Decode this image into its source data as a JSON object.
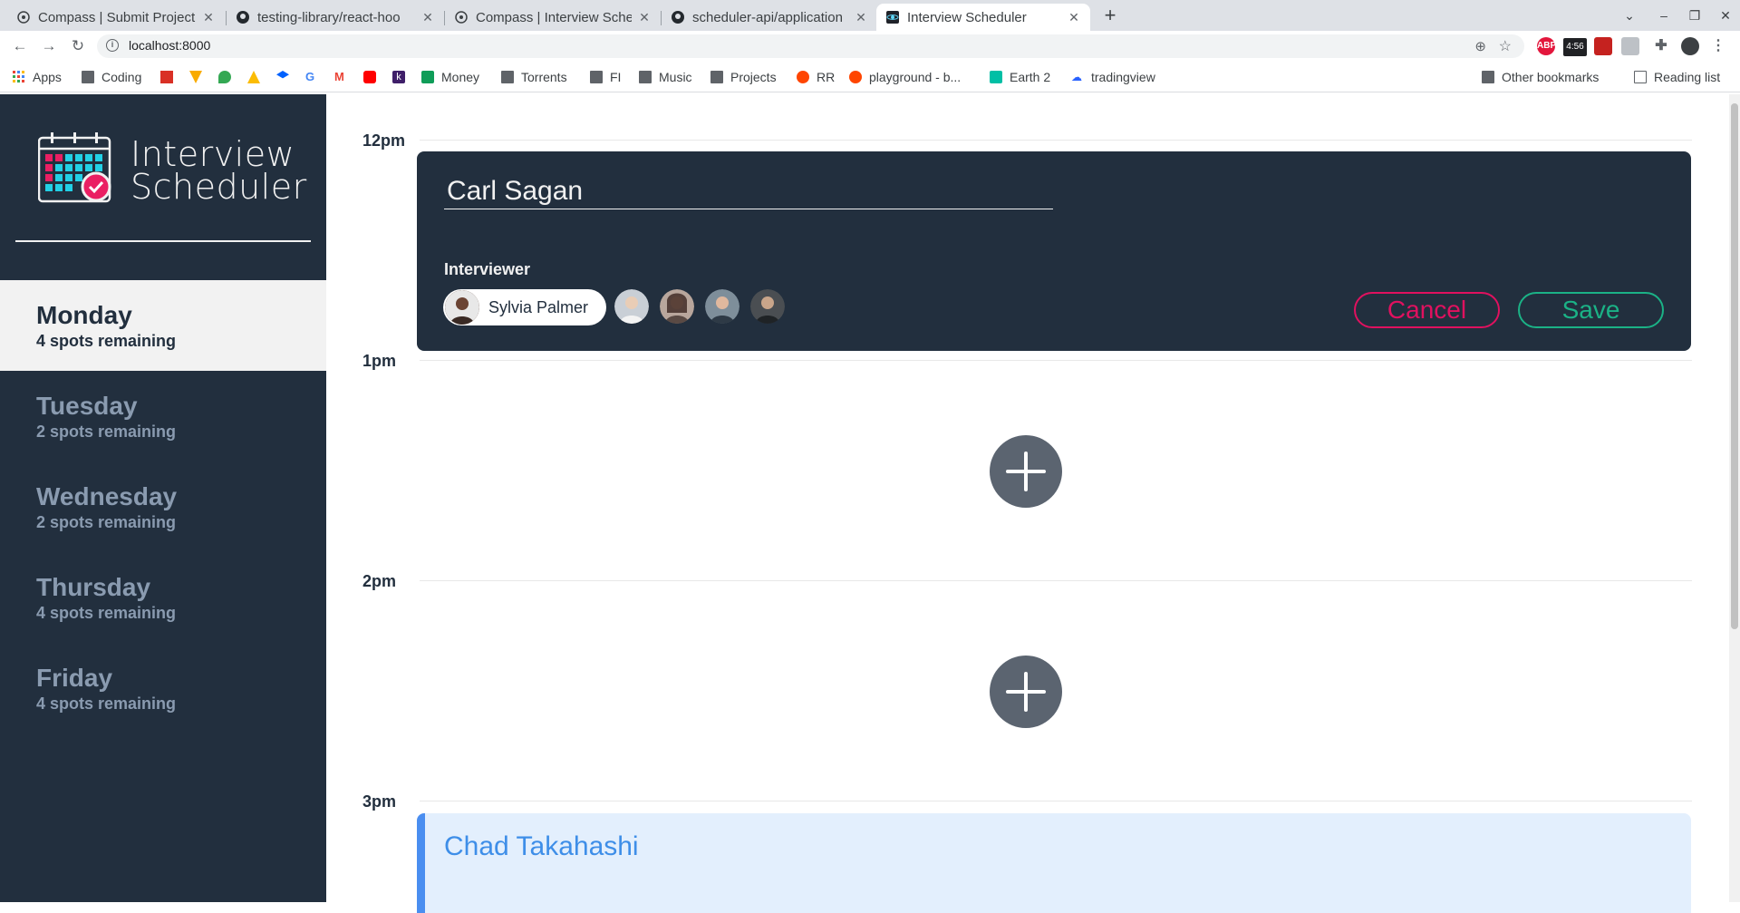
{
  "browser": {
    "tabs": [
      {
        "label": "Compass | Submit Project"
      },
      {
        "label": "testing-library/react-hoo"
      },
      {
        "label": "Compass | Interview Sche"
      },
      {
        "label": "scheduler-api/application"
      },
      {
        "label": "Interview Scheduler"
      }
    ],
    "url": "localhost:8000",
    "extension_clock": "4:56",
    "bookmarks": [
      "Apps",
      "Coding",
      "Money",
      "Torrents",
      "FI",
      "Music",
      "Projects",
      "RR",
      "playground - b...",
      "Earth 2",
      "tradingview"
    ],
    "other_bookmarks": "Other bookmarks",
    "reading_list": "Reading list"
  },
  "sidebar": {
    "logo_line1": "Interview",
    "logo_line2": "Scheduler",
    "days": [
      {
        "name": "Monday",
        "spots": "4 spots remaining",
        "selected": true
      },
      {
        "name": "Tuesday",
        "spots": "2 spots remaining",
        "selected": false
      },
      {
        "name": "Wednesday",
        "spots": "2 spots remaining",
        "selected": false
      },
      {
        "name": "Thursday",
        "spots": "4 spots remaining",
        "selected": false
      },
      {
        "name": "Friday",
        "spots": "4 spots remaining",
        "selected": false
      }
    ]
  },
  "schedule": {
    "times": [
      "12pm",
      "1pm",
      "2pm",
      "3pm"
    ],
    "form": {
      "student_name": "Carl Sagan",
      "interviewer_heading": "Interviewer",
      "selected_interviewer": "Sylvia Palmer",
      "cancel_label": "Cancel",
      "save_label": "Save"
    },
    "appointment": {
      "student": "Chad Takahashi"
    }
  },
  "colors": {
    "sidebar_bg": "#222f3e",
    "cancel": "#e0115f",
    "save": "#1bb286",
    "appointment_accent": "#4a8ef0"
  }
}
